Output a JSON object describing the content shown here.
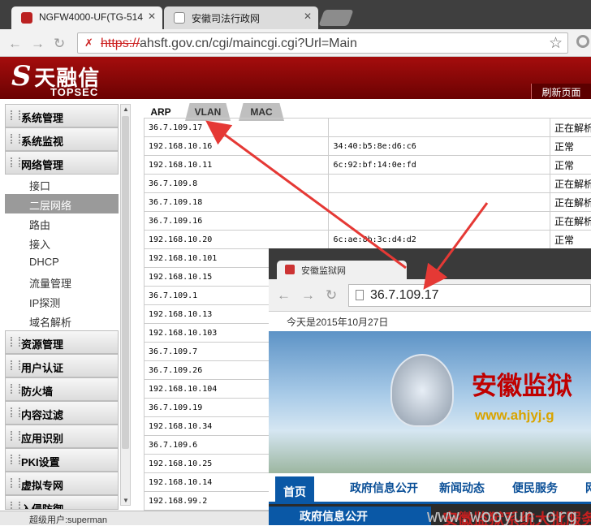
{
  "browser": {
    "tabs": [
      {
        "label": "NGFW4000-UF(TG-514"
      },
      {
        "label": "安徽司法行政网"
      }
    ],
    "url_prefix": "https://",
    "url": "ahsft.gov.cn/cgi/maincgi.cgi?Url=Main"
  },
  "header": {
    "logo_cn": "天融信",
    "logo_en": "TOPSEC",
    "refresh_label": "刷新页面"
  },
  "sidebar": {
    "items": [
      {
        "label": "系统管理"
      },
      {
        "label": "系统监视"
      },
      {
        "label": "网络管理"
      }
    ],
    "subitems": [
      {
        "label": "接口"
      },
      {
        "label": "二层网络"
      },
      {
        "label": "路由"
      },
      {
        "label": "接入"
      },
      {
        "label": "DHCP"
      },
      {
        "label": "流量管理"
      },
      {
        "label": "IP探测"
      },
      {
        "label": "域名解析"
      }
    ],
    "items2": [
      {
        "label": "资源管理"
      },
      {
        "label": "用户认证"
      },
      {
        "label": "防火墙"
      },
      {
        "label": "内容过滤"
      },
      {
        "label": "应用识别"
      },
      {
        "label": "PKI设置"
      },
      {
        "label": "虚拟专网"
      },
      {
        "label": "入侵防御"
      }
    ]
  },
  "content_tabs": [
    {
      "label": "ARP"
    },
    {
      "label": "VLAN"
    },
    {
      "label": "MAC"
    }
  ],
  "arp_rows": [
    {
      "ip": "36.7.109.17",
      "mac": "",
      "status": "正在解析"
    },
    {
      "ip": "192.168.10.16",
      "mac": "34:40:b5:8e:d6:c6",
      "status": "正常"
    },
    {
      "ip": "192.168.10.11",
      "mac": "6c:92:bf:14:0e:fd",
      "status": "正常"
    },
    {
      "ip": "36.7.109.8",
      "mac": "",
      "status": "正在解析"
    },
    {
      "ip": "36.7.109.18",
      "mac": "",
      "status": "正在解析"
    },
    {
      "ip": "36.7.109.16",
      "mac": "",
      "status": "正在解析"
    },
    {
      "ip": "192.168.10.20",
      "mac": "6c:ae:8b:3c:d4:d2",
      "status": "正常"
    },
    {
      "ip": "192.168.10.101",
      "mac": "",
      "status": ""
    },
    {
      "ip": "192.168.10.15",
      "mac": "",
      "status": ""
    },
    {
      "ip": "36.7.109.1",
      "mac": "",
      "status": ""
    },
    {
      "ip": "192.168.10.13",
      "mac": "",
      "status": ""
    },
    {
      "ip": "192.168.10.103",
      "mac": "",
      "status": ""
    },
    {
      "ip": "36.7.109.7",
      "mac": "",
      "status": ""
    },
    {
      "ip": "36.7.109.26",
      "mac": "",
      "status": ""
    },
    {
      "ip": "192.168.10.104",
      "mac": "",
      "status": ""
    },
    {
      "ip": "36.7.109.19",
      "mac": "",
      "status": ""
    },
    {
      "ip": "192.168.10.34",
      "mac": "",
      "status": ""
    },
    {
      "ip": "36.7.109.6",
      "mac": "",
      "status": ""
    },
    {
      "ip": "192.168.10.25",
      "mac": "",
      "status": ""
    },
    {
      "ip": "192.168.10.14",
      "mac": "",
      "status": ""
    },
    {
      "ip": "192.168.99.2",
      "mac": "",
      "status": ""
    }
  ],
  "statusbar": "超级用户:superman",
  "overlay": {
    "tab": "安徽监狱网",
    "url": "36.7.109.17",
    "date": "今天是2015年10月27日",
    "banner_title": "安徽监狱",
    "banner_url": "www.ahjyj.g",
    "nav": [
      {
        "label": "首页"
      },
      {
        "label": "政府信息公开"
      },
      {
        "label": "新闻动态"
      },
      {
        "label": "便民服务"
      },
      {
        "label": "网"
      }
    ],
    "section": "政府信息公开",
    "watermark": "www.wooyun.org",
    "red_text": "安徽监狱系统大批服务"
  },
  "colors": {
    "brand_red": "#a50d0d",
    "arrow": "#e53935",
    "nav_blue": "#0a58a6"
  }
}
